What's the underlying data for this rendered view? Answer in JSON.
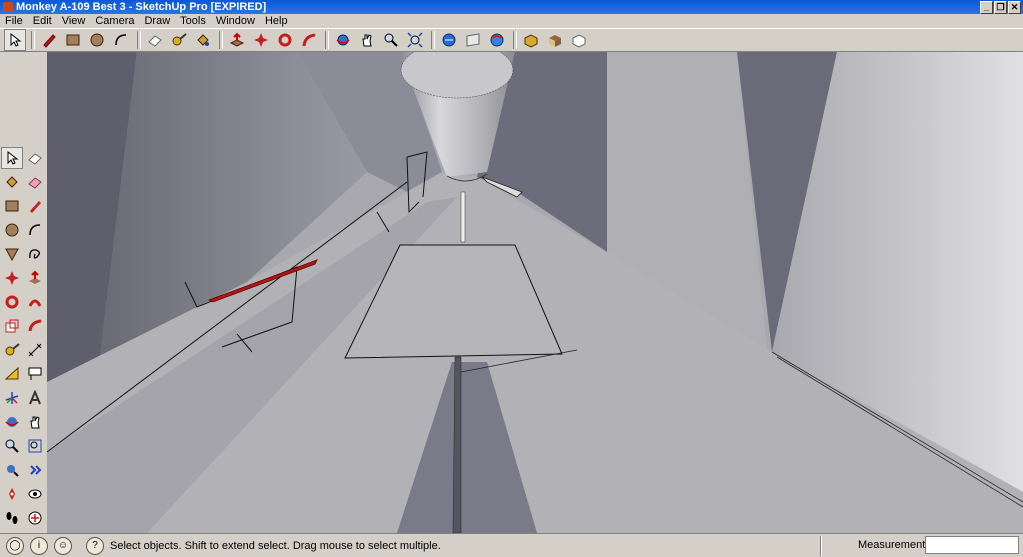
{
  "window": {
    "title": "Monkey A-109 Best 3 - SketchUp Pro [EXPIRED]",
    "minimize": "_",
    "restore": "❐",
    "close": "✕"
  },
  "menu": [
    "File",
    "Edit",
    "View",
    "Camera",
    "Draw",
    "Tools",
    "Window",
    "Help"
  ],
  "toolbar": {
    "icons": [
      "select-arrow-icon",
      "pencil-icon",
      "rectangle-icon",
      "circle-icon",
      "arc-icon",
      "eraser-icon",
      "tape-measure-icon",
      "paint-bucket-icon",
      "push-pull-icon",
      "move-icon",
      "rotate-icon",
      "follow-me-icon",
      "orbit-icon",
      "pan-icon",
      "zoom-icon",
      "zoom-extents-icon",
      "get-models-icon",
      "share-model-icon",
      "google-earth-icon",
      "components-icon",
      "materials-icon",
      "styles-icon"
    ]
  },
  "left_tools": [
    "select-icon",
    "eraser-icon",
    "paint-bucket-icon",
    "eraser-pink-icon",
    "rectangle-icon",
    "line-icon",
    "circle-icon",
    "arc-icon",
    "polygon-icon",
    "freehand-icon",
    "move-icon",
    "push-pull-icon",
    "rotate-icon",
    "follow-me-icon",
    "scale-icon",
    "offset-icon",
    "tape-measure-icon",
    "dimension-icon",
    "protractor-icon",
    "text-icon",
    "axes-icon",
    "3d-text-icon",
    "orbit-icon",
    "pan-icon",
    "zoom-icon",
    "zoom-window-icon",
    "zoom-extents-icon",
    "previous-view-icon",
    "position-camera-icon",
    "look-around-icon",
    "walk-icon",
    "section-plane-icon"
  ],
  "status": {
    "hint": "Select objects. Shift to extend select. Drag mouse to select multiple.",
    "measurements_label": "Measurements",
    "measurements_value": ""
  },
  "colors": {
    "title_bar": "#0a58d8",
    "chrome": "#d4d0c8",
    "selection_red": "#b01818"
  }
}
